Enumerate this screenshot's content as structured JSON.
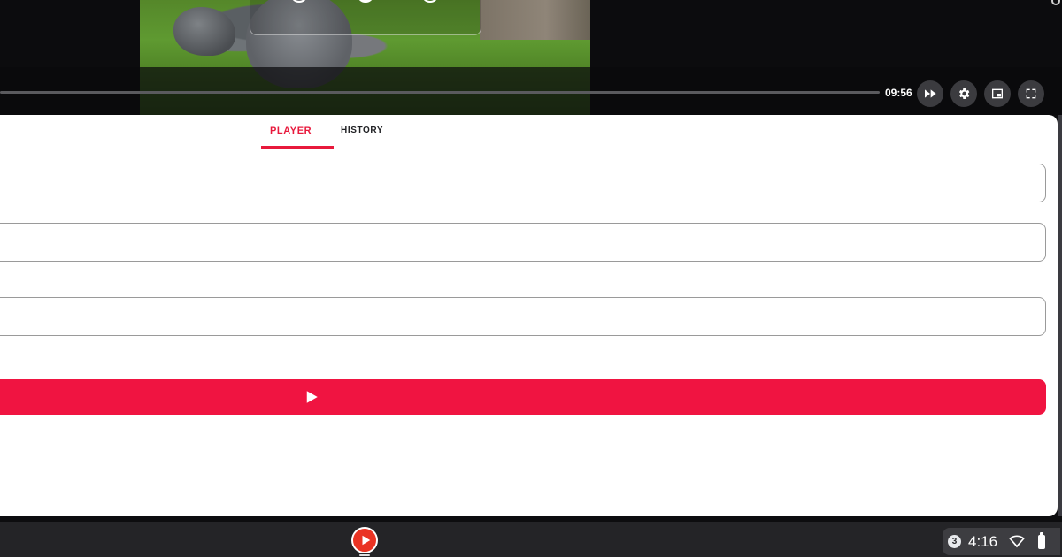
{
  "player": {
    "current_time": "09:56",
    "controls": [
      {
        "name": "fast-forward-icon"
      },
      {
        "name": "gear-icon"
      },
      {
        "name": "picture-in-picture-icon"
      },
      {
        "name": "fullscreen-icon"
      }
    ]
  },
  "tabs": [
    {
      "label": "Player",
      "active": true
    },
    {
      "label": "History",
      "active": false
    }
  ],
  "form": {
    "field_1": {
      "value": "",
      "placeholder": ""
    },
    "field_2": {
      "value": "",
      "placeholder": ""
    },
    "field_3": {
      "value": "",
      "placeholder": ""
    },
    "play_button_icon": "play-icon"
  },
  "colors": {
    "accent": "#e8193c",
    "play_button": "#f01441",
    "shelf_app": "#ea3323"
  },
  "shelf": {
    "app_icon": "play-circle-icon",
    "notification_count": "3",
    "clock": "4:16",
    "wifi_icon": "wifi-icon",
    "battery_icon": "battery-icon"
  }
}
